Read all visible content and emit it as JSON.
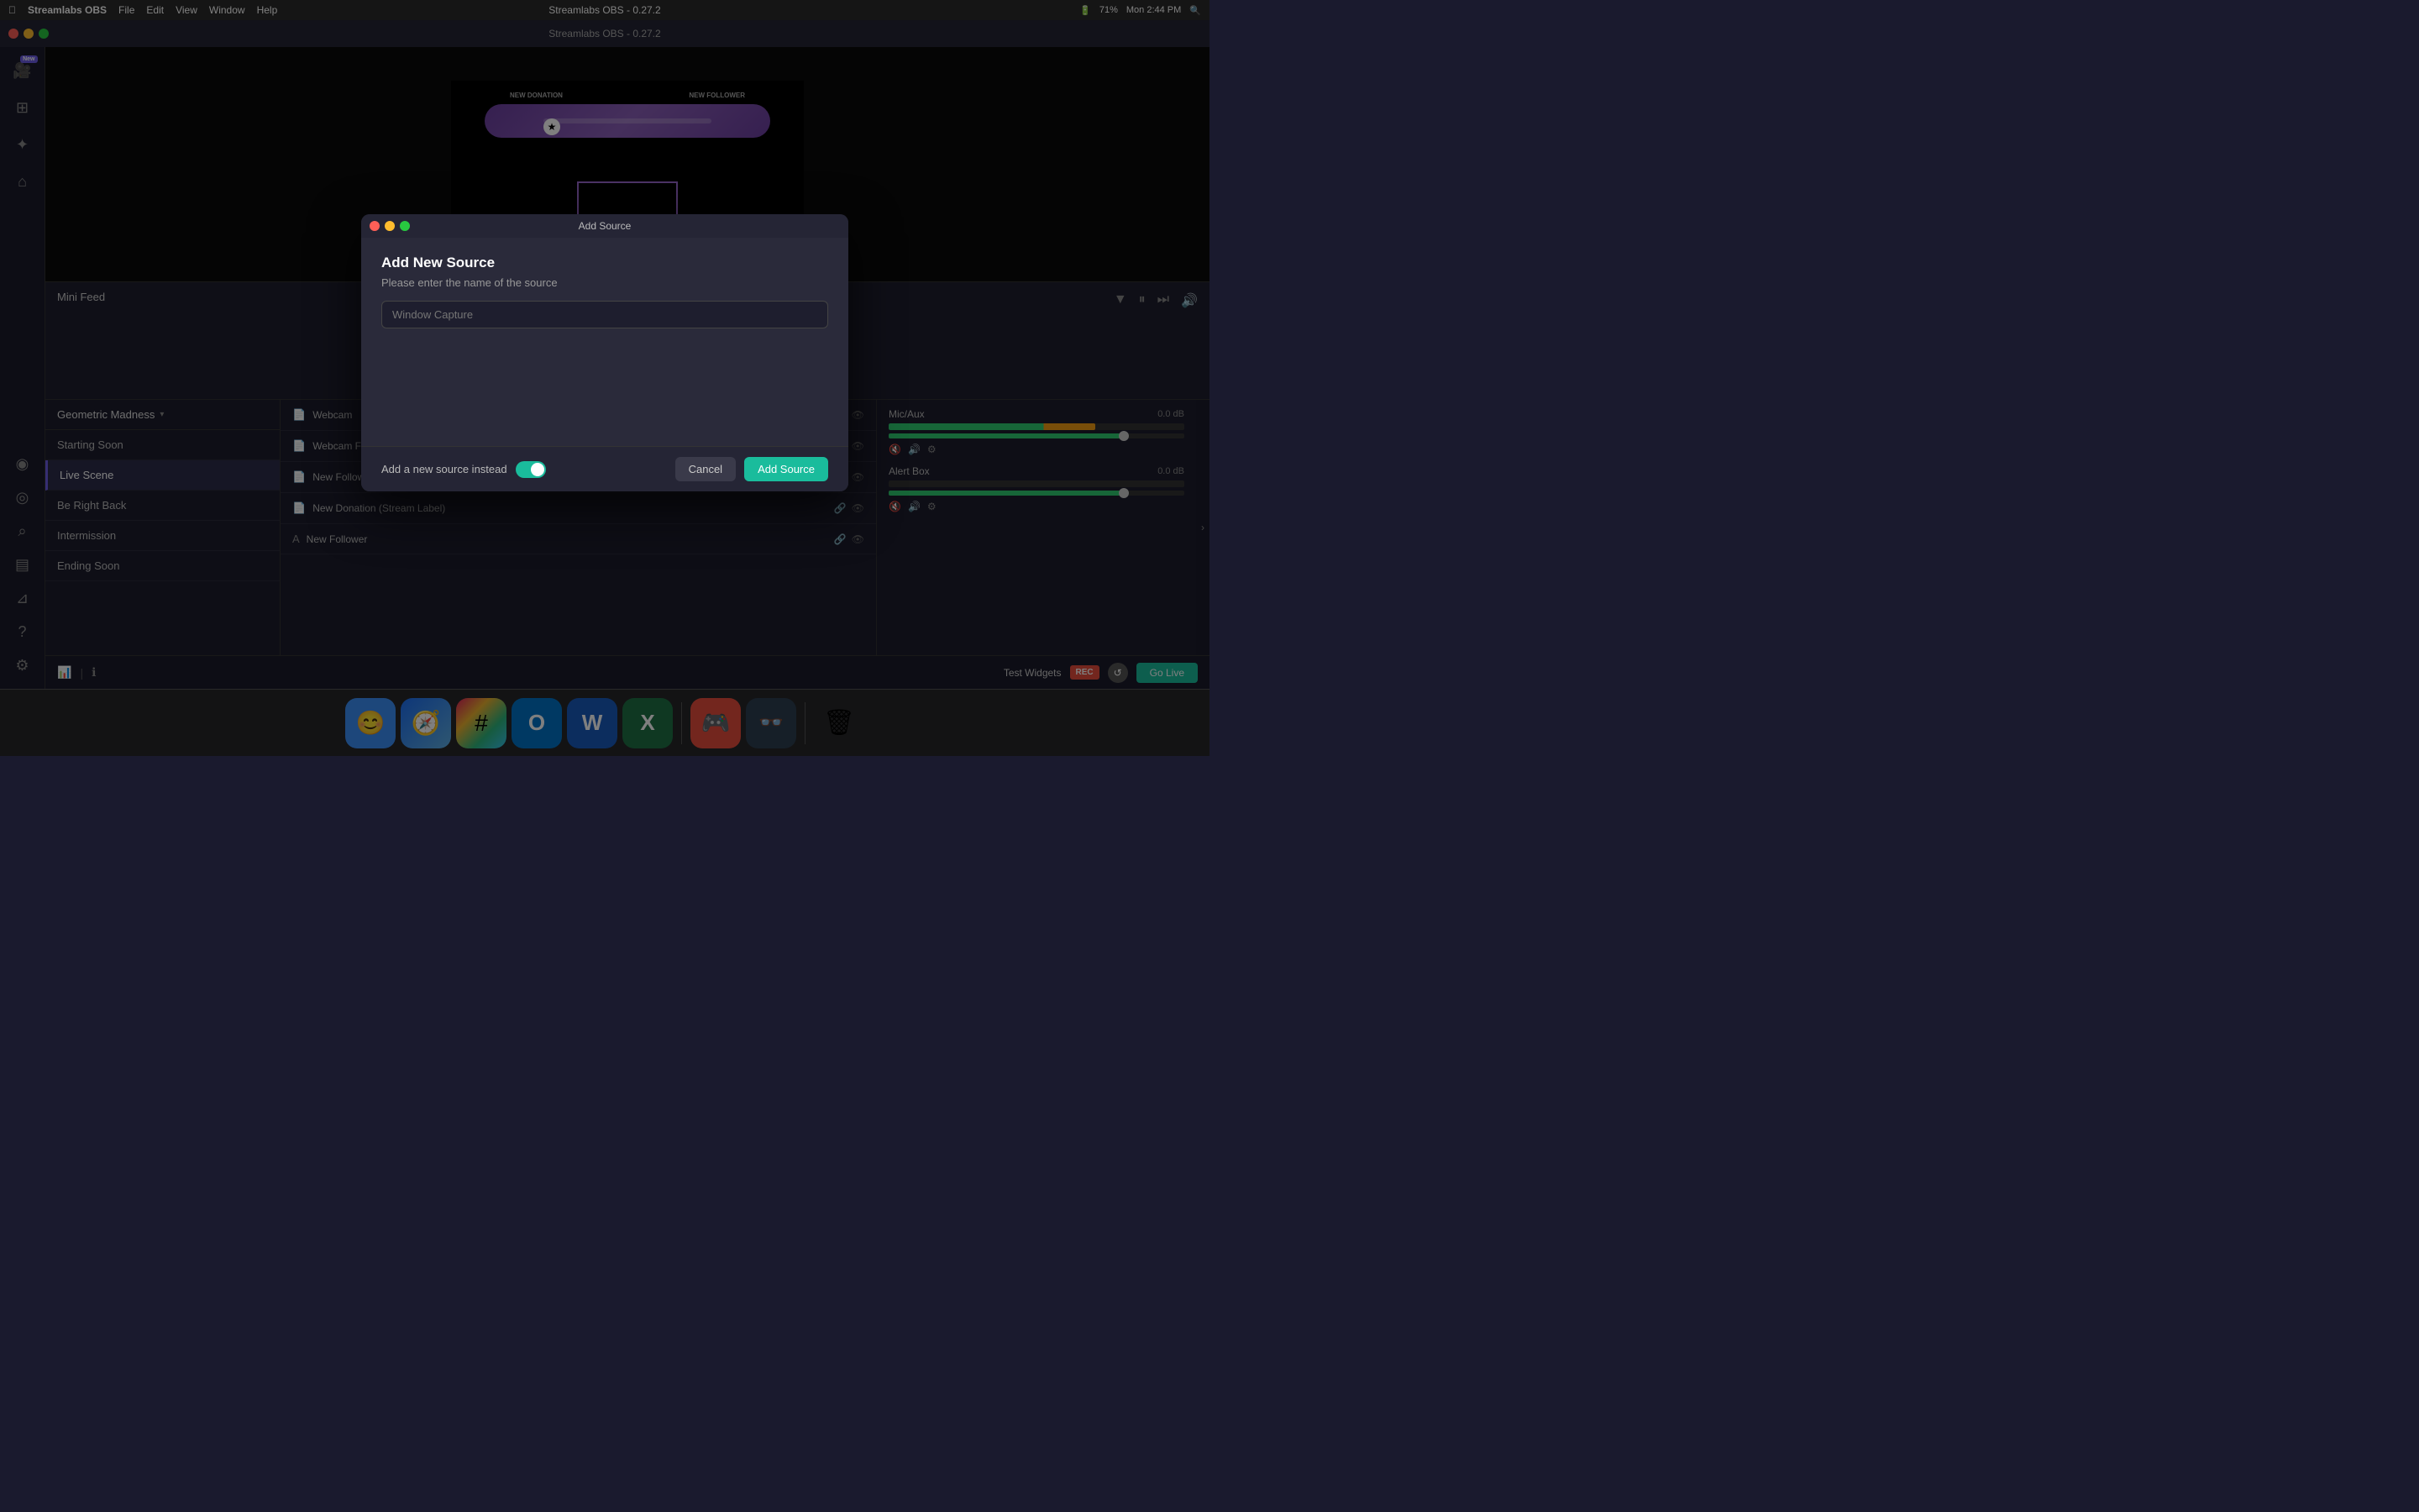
{
  "menubar": {
    "app_name": "Streamlabs OBS",
    "menus": [
      "File",
      "Edit",
      "View",
      "Window",
      "Help"
    ],
    "title": "Streamlabs OBS - 0.27.2",
    "time": "Mon 2:44 PM",
    "battery": "71%"
  },
  "sidebar": {
    "items": [
      {
        "id": "live",
        "icon": "▶",
        "label": "Live",
        "badge": "New"
      },
      {
        "id": "scenes",
        "icon": "⊞",
        "label": "Scenes"
      },
      {
        "id": "effects",
        "icon": "✦",
        "label": "Effects"
      },
      {
        "id": "themes",
        "icon": "⌂",
        "label": "Themes"
      }
    ],
    "bottom_items": [
      {
        "id": "stats",
        "icon": "◉",
        "label": "Stats"
      },
      {
        "id": "feed",
        "icon": "◎",
        "label": "Feed"
      },
      {
        "id": "search",
        "icon": "⌕",
        "label": "Search"
      },
      {
        "id": "grid",
        "icon": "⊟",
        "label": "Grid"
      },
      {
        "id": "charts",
        "icon": "⊿",
        "label": "Charts"
      },
      {
        "id": "help",
        "icon": "?",
        "label": "Help"
      },
      {
        "id": "settings",
        "icon": "⚙",
        "label": "Settings"
      }
    ]
  },
  "preview": {
    "new_donation_label": "NEW DONATION",
    "new_follower_label": "NEW FOLLOWER"
  },
  "mini_feed": {
    "title": "Mini Feed"
  },
  "scenes": {
    "title": "Geometric Madness",
    "items": [
      {
        "id": "starting-soon",
        "label": "Starting Soon",
        "active": false
      },
      {
        "id": "live-scene",
        "label": "Live Scene",
        "active": true
      },
      {
        "id": "be-right-back",
        "label": "Be Right Back",
        "active": false
      },
      {
        "id": "intermission",
        "label": "Intermission",
        "active": false
      },
      {
        "id": "ending-soon",
        "label": "Ending Soon",
        "active": false
      }
    ]
  },
  "sources": {
    "items": [
      {
        "id": "webcam",
        "label": "Webcam",
        "type": "doc"
      },
      {
        "id": "webcam-frame",
        "label": "Webcam Frame",
        "type": "doc"
      },
      {
        "id": "new-follower-stream",
        "label": "New Follower (Stream Label)",
        "type": "doc"
      },
      {
        "id": "new-donation-stream",
        "label": "New Donation (Stream Label)",
        "type": "doc"
      },
      {
        "id": "new-follower",
        "label": "New Follower",
        "type": "text"
      }
    ]
  },
  "mixer": {
    "items": [
      {
        "id": "mic-aux",
        "name": "Mic/Aux",
        "db": "0.0 dB",
        "fill_pct": 70,
        "orange_start": 85
      },
      {
        "id": "alert-box",
        "name": "Alert Box",
        "db": "0.0 dB",
        "fill_pct": 0
      }
    ]
  },
  "toolbar": {
    "test_widgets_label": "Test Widgets",
    "rec_label": "REC",
    "go_live_label": "Go Live"
  },
  "modal": {
    "title": "Add Source",
    "heading": "Add New Source",
    "subtext": "Please enter the name of the source",
    "input_placeholder": "Window Capture",
    "toggle_label": "Add a new source instead",
    "cancel_label": "Cancel",
    "add_source_label": "Add Source"
  },
  "dock": {
    "items": [
      {
        "id": "finder",
        "bg": "#3a8ef6",
        "label": "Finder"
      },
      {
        "id": "safari",
        "bg": "#1c6ef2",
        "label": "Safari"
      },
      {
        "id": "slack",
        "bg": "#4a154b",
        "label": "Slack"
      },
      {
        "id": "outlook",
        "bg": "#0072c6",
        "label": "Outlook"
      },
      {
        "id": "word",
        "bg": "#185abd",
        "label": "Word"
      },
      {
        "id": "excel",
        "bg": "#1e7145",
        "label": "Excel"
      },
      {
        "id": "squads",
        "bg": "#e74c3c",
        "label": "Squads"
      },
      {
        "id": "streamlabs",
        "bg": "#2c3e50",
        "label": "Streamlabs"
      },
      {
        "id": "trash",
        "bg": "transparent",
        "label": "Trash"
      }
    ]
  }
}
